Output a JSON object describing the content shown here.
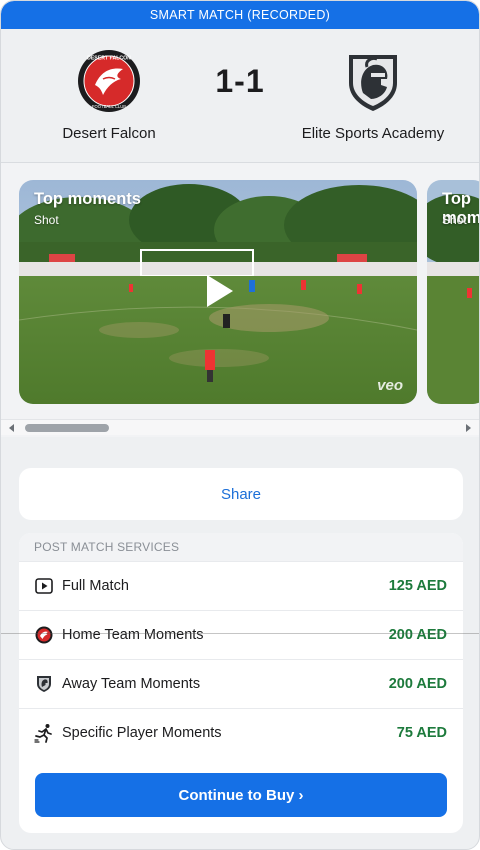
{
  "header": {
    "title": "SMART MATCH (RECORDED)"
  },
  "match": {
    "home": {
      "name": "Desert Falcon",
      "crest_text": "DESERT FALCON",
      "crest_sub": "FOOTBALL CLUB",
      "color": "#d62a2a"
    },
    "away": {
      "name": "Elite Sports Academy",
      "color": "#2d3136"
    },
    "score": "1-1"
  },
  "carousel": {
    "cards": [
      {
        "title": "Top moments",
        "subtitle": "Shot",
        "watermark": "veo"
      },
      {
        "title": "Top moments",
        "subtitle": "Shot"
      }
    ]
  },
  "share": {
    "label": "Share"
  },
  "services": {
    "heading": "POST MATCH SERVICES",
    "items": [
      {
        "icon": "play-square-icon",
        "name": "Full Match",
        "price": "125 AED"
      },
      {
        "icon": "home-team-crest-icon",
        "name": "Home Team Moments",
        "price": "200 AED"
      },
      {
        "icon": "away-team-crest-icon",
        "name": "Away Team Moments",
        "price": "200 AED"
      },
      {
        "icon": "running-player-icon",
        "name": "Specific Player Moments",
        "price": "75 AED"
      }
    ],
    "cta": "Continue to Buy ›"
  },
  "colors": {
    "accent": "#1570e6",
    "price": "#1d7a3c",
    "link": "#1b6fd8"
  }
}
